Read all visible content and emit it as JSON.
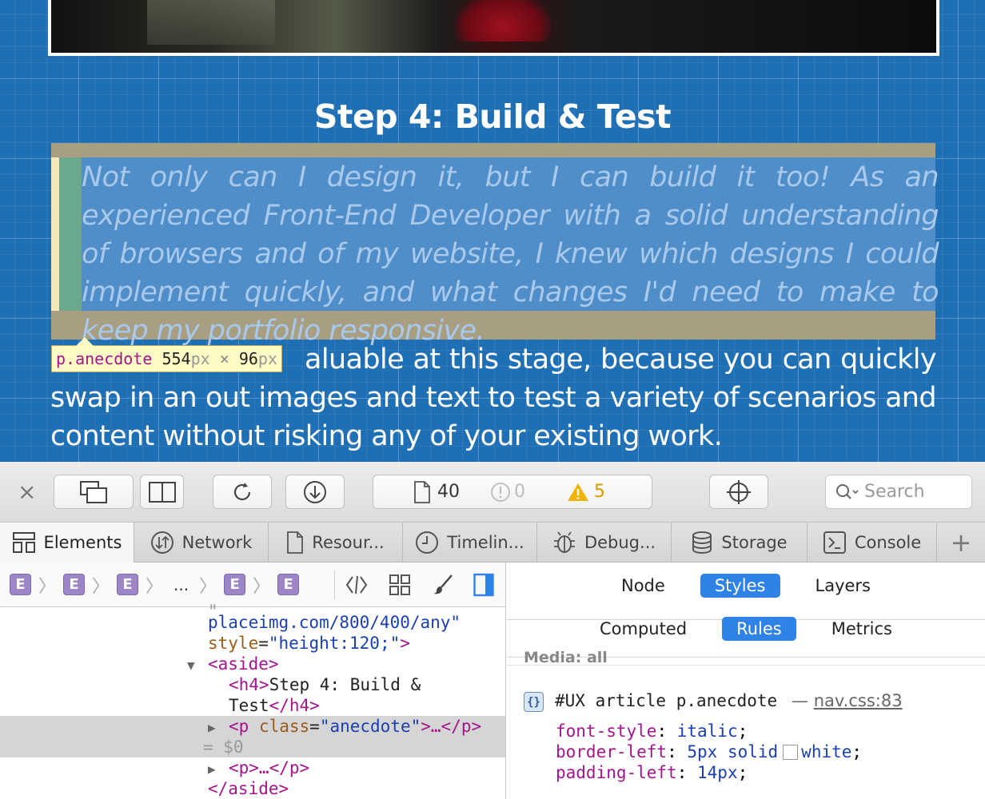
{
  "page": {
    "heading": "Step 4: Build & Test",
    "anecdote": "Not only can I design it, but I can build it too! As an experienced Front-End Developer with a solid understanding of browsers and of my website, I knew which designs I could implement quickly, and what changes I'd need to make to keep my portfolio responsive.",
    "body_paragraph_visible": "aluable at this stage, because you can quickly swap in an out images and text to test a variety of scenarios and content without risking any of your existing work."
  },
  "tooltip": {
    "selector": "p.anecdote",
    "width": "554",
    "height": "96",
    "unit": "px",
    "times": "×"
  },
  "toolbar": {
    "close": "×",
    "resource_count": "40",
    "error_count": "0",
    "warning_count": "5",
    "search_placeholder": "Search"
  },
  "tabs": [
    {
      "label": "Elements"
    },
    {
      "label": "Network"
    },
    {
      "label": "Resour..."
    },
    {
      "label": "Timelin..."
    },
    {
      "label": "Debug..."
    },
    {
      "label": "Storage"
    },
    {
      "label": "Console"
    },
    {
      "label": "+"
    }
  ],
  "breadcrumbs": {
    "crumb": "E",
    "ellipsis": "..."
  },
  "dom": {
    "line1_url": "placeimg.com/800/400/any\"",
    "line2_attr": "style",
    "line2_val": "\"height:120;\"",
    "line2_close": ">",
    "aside_open": "<aside>",
    "h4_open": "<h4>",
    "h4_text_1": "Step 4: Build &",
    "h4_text_2": "Test",
    "h4_close": "</h4>",
    "p_open": "<p",
    "p_attr": "class",
    "p_val": "\"anecdote\"",
    "p_rest": ">…</p>",
    "dollar0": "= $0",
    "p2": "<p>…</p>",
    "aside_close": "</aside>"
  },
  "styles": {
    "top_tabs": [
      "Node",
      "Styles",
      "Layers"
    ],
    "active_top": "Styles",
    "sub_tabs": [
      "Computed",
      "Rules",
      "Metrics"
    ],
    "active_sub": "Rules",
    "media": "Media: all",
    "rule_selector": "#UX article p.anecdote",
    "rule_source_dash": "—",
    "rule_source": "nav.css:83",
    "decls": [
      {
        "prop": "font-style",
        "value": "italic"
      },
      {
        "prop": "border-left",
        "value": "5px solid",
        "color_name": "white"
      },
      {
        "prop": "padding-left",
        "value": "14px"
      }
    ]
  },
  "colors": {
    "blueprint": "#1f6fb5",
    "accent": "#2f82e6",
    "tag": "#a3148e",
    "warning": "#e0a000"
  }
}
